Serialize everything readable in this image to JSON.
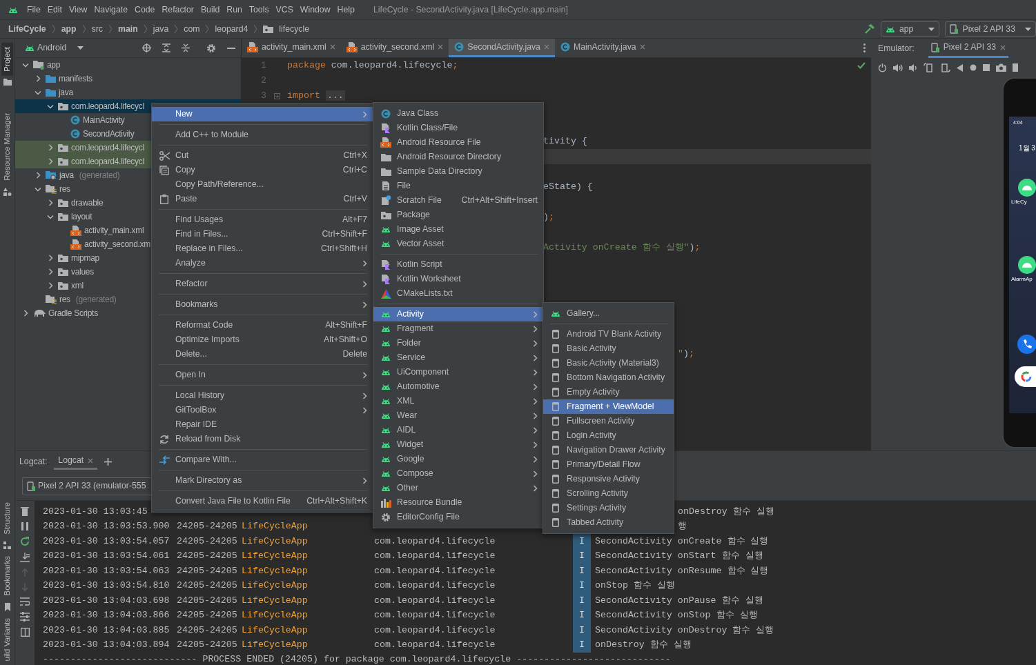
{
  "menubar": {
    "items": [
      "File",
      "Edit",
      "View",
      "Navigate",
      "Code",
      "Refactor",
      "Build",
      "Run",
      "Tools",
      "VCS",
      "Window",
      "Help"
    ],
    "title": "LifeCycle - SecondActivity.java [LifeCycle.app.main]"
  },
  "navbar": {
    "breadcrumbs": [
      {
        "label": "LifeCycle",
        "bold": true
      },
      {
        "label": "app",
        "bold": true
      },
      {
        "label": "src",
        "bold": false
      },
      {
        "label": "main",
        "bold": true
      },
      {
        "label": "java",
        "bold": false
      },
      {
        "label": "com",
        "bold": false
      },
      {
        "label": "leopard4",
        "bold": false
      },
      {
        "label": "lifecycle",
        "bold": false,
        "kind": "package"
      }
    ],
    "run_config": "app",
    "device": "Pixel 2 API 33"
  },
  "toolstrip": [
    {
      "label": "Project",
      "selected": true
    },
    {
      "label": "Resource Manager",
      "selected": false
    },
    {
      "label": "Structure",
      "selected": false
    },
    {
      "label": "Bookmarks",
      "selected": false
    },
    {
      "label": "uild Variants",
      "selected": false
    }
  ],
  "project": {
    "view": "Android",
    "tree": [
      {
        "label": "app",
        "kind": "module",
        "expanded": true,
        "selected": false,
        "children": [
          {
            "label": "manifests",
            "kind": "source",
            "expanded": false,
            "selected": false
          },
          {
            "label": "java",
            "kind": "source",
            "expanded": true,
            "selected": false,
            "children": [
              {
                "label": "com.leopard4.lifecycl",
                "kind": "package",
                "expanded": true,
                "selected": true,
                "children": [
                  {
                    "label": "MainActivity",
                    "kind": "class",
                    "selected": false
                  },
                  {
                    "label": "SecondActivity",
                    "kind": "class",
                    "selected": false
                  }
                ]
              },
              {
                "label": "com.leopard4.lifecycl",
                "kind": "package",
                "expanded": false,
                "selected": false,
                "test": true
              },
              {
                "label": "com.leopard4.lifecycl",
                "kind": "package",
                "expanded": false,
                "selected": false,
                "test": true
              }
            ]
          },
          {
            "label": "java",
            "suffix": "(generated)",
            "kind": "generated",
            "expanded": false,
            "selected": false
          },
          {
            "label": "res",
            "kind": "res",
            "expanded": true,
            "selected": false,
            "children": [
              {
                "label": "drawable",
                "kind": "package",
                "expanded": false,
                "selected": false
              },
              {
                "label": "layout",
                "kind": "package",
                "expanded": true,
                "selected": false,
                "children": [
                  {
                    "label": "activity_main.xml",
                    "kind": "xml",
                    "selected": false
                  },
                  {
                    "label": "activity_second.xm",
                    "kind": "xml",
                    "selected": false
                  }
                ]
              },
              {
                "label": "mipmap",
                "kind": "package",
                "expanded": false,
                "selected": false
              },
              {
                "label": "values",
                "kind": "package",
                "expanded": false,
                "selected": false
              },
              {
                "label": "xml",
                "kind": "package",
                "expanded": false,
                "selected": false
              }
            ]
          },
          {
            "label": "res",
            "suffix": "(generated)",
            "kind": "res",
            "selected": false
          }
        ]
      },
      {
        "label": "Gradle Scripts",
        "kind": "gradle",
        "expanded": false,
        "selected": false
      }
    ]
  },
  "editor": {
    "tabs": [
      {
        "label": "activity_main.xml",
        "kind": "xml",
        "selected": false
      },
      {
        "label": "activity_second.xml",
        "kind": "xml",
        "selected": false
      },
      {
        "label": "SecondActivity.java",
        "kind": "class",
        "selected": true
      },
      {
        "label": "MainActivity.java",
        "kind": "class",
        "selected": false
      }
    ],
    "analysis_ok": true,
    "lines": [
      {
        "number": "1",
        "fold_marker": false,
        "tokens": [
          {
            "text": "package",
            "kind": "keyword"
          },
          {
            "text": " com.leopard4.lifecycle",
            "kind": "plain"
          },
          {
            "text": ";",
            "kind": "keyword"
          }
        ]
      },
      {
        "number": "2",
        "fold_marker": false
      },
      {
        "number": "3",
        "fold_marker": true,
        "tokens": [
          {
            "text": "import",
            "kind": "keyword"
          },
          {
            "text": "...",
            "kind": "folded"
          }
        ]
      }
    ],
    "fragments": [
      {
        "current": false,
        "tokens": [
          {
            "text": "tivity {",
            "kind": "plain"
          }
        ]
      },
      {
        "current": true
      },
      {
        "current": false,
        "tokens": [
          {
            "text": "eState) {",
            "kind": "plain"
          }
        ]
      },
      {
        "current": false,
        "tokens": [
          {
            "text": ")",
            "kind": "plain"
          },
          {
            "text": ";",
            "kind": "keyword"
          }
        ]
      },
      {
        "current": false,
        "tokens": [
          {
            "text": "Activity onCreate 함수 실행\"",
            "kind": "string"
          },
          {
            "text": ")",
            "kind": "plain"
          },
          {
            "text": ";",
            "kind": "keyword"
          }
        ]
      },
      {
        "current": false,
        "tokens": [
          {
            "text": "\"",
            "kind": "string"
          },
          {
            "text": ")",
            "kind": "plain"
          },
          {
            "text": ";",
            "kind": "keyword"
          }
        ]
      }
    ]
  },
  "emulator": {
    "label": "Emulator:",
    "tab": "Pixel 2 API 33",
    "screen": {
      "time": "4:04",
      "date": "1월 3",
      "apps": [
        {
          "label": "LifeCy"
        },
        {
          "label": "AlarmAp"
        }
      ]
    }
  },
  "logcat": {
    "label": "Logcat:",
    "tab": "Logcat",
    "device": "Pixel 2 API 33 (emulator-555",
    "rows": [
      {
        "time": "2023-01-30 13:03:45",
        "message": "onDestroy 함수 실행",
        "partly_hidden": true
      },
      {
        "time": "2023-01-30 13:03:53.900",
        "pid": "24205-24205",
        "tag": "LifeCycleApp",
        "message": "행",
        "partly_hidden": true
      },
      {
        "time": "2023-01-30 13:03:54.057",
        "pid": "24205-24205",
        "tag": "LifeCycleApp",
        "package": "com.leopard4.lifecycle",
        "level": "I",
        "message": "SecondActivity onCreate 함수 실행",
        "partly_hidden": false
      },
      {
        "time": "2023-01-30 13:03:54.061",
        "pid": "24205-24205",
        "tag": "LifeCycleApp",
        "package": "com.leopard4.lifecycle",
        "level": "I",
        "message": "SecondActivity onStart 함수 실행",
        "partly_hidden": false
      },
      {
        "time": "2023-01-30 13:03:54.063",
        "pid": "24205-24205",
        "tag": "LifeCycleApp",
        "package": "com.leopard4.lifecycle",
        "level": "I",
        "message": "SecondActivity onResume 함수 실행",
        "partly_hidden": false
      },
      {
        "time": "2023-01-30 13:03:54.810",
        "pid": "24205-24205",
        "tag": "LifeCycleApp",
        "package": "com.leopard4.lifecycle",
        "level": "I",
        "message": "onStop 함수 실행",
        "partly_hidden": false
      },
      {
        "time": "2023-01-30 13:04:03.698",
        "pid": "24205-24205",
        "tag": "LifeCycleApp",
        "package": "com.leopard4.lifecycle",
        "level": "I",
        "message": "SecondActivity onPause 함수 실행",
        "partly_hidden": false
      },
      {
        "time": "2023-01-30 13:04:03.866",
        "pid": "24205-24205",
        "tag": "LifeCycleApp",
        "package": "com.leopard4.lifecycle",
        "level": "I",
        "message": "SecondActivity onStop 함수 실행",
        "partly_hidden": false
      },
      {
        "time": "2023-01-30 13:04:03.885",
        "pid": "24205-24205",
        "tag": "LifeCycleApp",
        "package": "com.leopard4.lifecycle",
        "level": "I",
        "message": "SecondActivity onDestroy 함수 실행",
        "partly_hidden": false
      },
      {
        "time": "2023-01-30 13:04:03.894",
        "pid": "24205-24205",
        "tag": "LifeCycleApp",
        "package": "com.leopard4.lifecycle",
        "level": "I",
        "message": "onDestroy 함수 실행",
        "partly_hidden": false
      }
    ],
    "footer": "---------------------------- PROCESS ENDED (24205) for package com.leopard4.lifecycle ----------------------------"
  },
  "context_menu": {
    "groups": [
      [
        {
          "label": "New",
          "submenu": true,
          "selected": true
        }
      ],
      [
        {
          "label": "Add C++ to Module",
          "submenu": false,
          "selected": false
        }
      ],
      [
        {
          "label": "Cut",
          "shortcut": "Ctrl+X",
          "kind": "cut",
          "submenu": false,
          "selected": false
        },
        {
          "label": "Copy",
          "shortcut": "Ctrl+C",
          "kind": "copy",
          "submenu": false,
          "selected": false
        },
        {
          "label": "Copy Path/Reference...",
          "submenu": false,
          "selected": false
        },
        {
          "label": "Paste",
          "shortcut": "Ctrl+V",
          "kind": "paste",
          "submenu": false,
          "selected": false
        }
      ],
      [
        {
          "label": "Find Usages",
          "shortcut": "Alt+F7",
          "submenu": false,
          "selected": false
        },
        {
          "label": "Find in Files...",
          "shortcut": "Ctrl+Shift+F",
          "submenu": false,
          "selected": false
        },
        {
          "label": "Replace in Files...",
          "shortcut": "Ctrl+Shift+H",
          "submenu": false,
          "selected": false
        },
        {
          "label": "Analyze",
          "submenu": true,
          "selected": false
        }
      ],
      [
        {
          "label": "Refactor",
          "submenu": true,
          "selected": false
        }
      ],
      [
        {
          "label": "Bookmarks",
          "submenu": true,
          "selected": false
        }
      ],
      [
        {
          "label": "Reformat Code",
          "shortcut": "Alt+Shift+F",
          "submenu": false,
          "selected": false
        },
        {
          "label": "Optimize Imports",
          "shortcut": "Alt+Shift+O",
          "submenu": false,
          "selected": false
        },
        {
          "label": "Delete...",
          "shortcut": "Delete",
          "submenu": false,
          "selected": false
        }
      ],
      [
        {
          "label": "Open In",
          "submenu": true,
          "selected": false
        }
      ],
      [
        {
          "label": "Local History",
          "submenu": true,
          "selected": false
        },
        {
          "label": "GitToolBox",
          "submenu": true,
          "selected": false
        },
        {
          "label": "Repair IDE",
          "submenu": false,
          "selected": false
        },
        {
          "label": "Reload from Disk",
          "kind": "reload",
          "submenu": false,
          "selected": false
        }
      ],
      [
        {
          "label": "Compare With...",
          "kind": "compare",
          "submenu": false,
          "selected": false
        }
      ],
      [
        {
          "label": "Mark Directory as",
          "submenu": true,
          "selected": false
        }
      ],
      [
        {
          "label": "Convert Java File to Kotlin File",
          "shortcut": "Ctrl+Alt+Shift+K",
          "submenu": false,
          "selected": false
        }
      ]
    ]
  },
  "new_menu": {
    "groups": [
      [
        {
          "label": "Java Class",
          "kind": "class",
          "submenu": false,
          "selected": false
        },
        {
          "label": "Kotlin Class/File",
          "kind": "kotlin",
          "submenu": false,
          "selected": false
        },
        {
          "label": "Android Resource File",
          "kind": "xml",
          "submenu": false,
          "selected": false
        },
        {
          "label": "Android Resource Directory",
          "kind": "folder",
          "submenu": false,
          "selected": false
        },
        {
          "label": "Sample Data Directory",
          "kind": "folder",
          "submenu": false,
          "selected": false
        },
        {
          "label": "File",
          "kind": "file",
          "submenu": false,
          "selected": false
        },
        {
          "label": "Scratch File",
          "shortcut": "Ctrl+Alt+Shift+Insert",
          "kind": "scratch",
          "submenu": false,
          "selected": false
        },
        {
          "label": "Package",
          "kind": "package",
          "submenu": false,
          "selected": false
        },
        {
          "label": "Image Asset",
          "kind": "android",
          "submenu": false,
          "selected": false
        },
        {
          "label": "Vector Asset",
          "kind": "android",
          "submenu": false,
          "selected": false
        }
      ],
      [
        {
          "label": "Kotlin Script",
          "kind": "kotlin",
          "submenu": false,
          "selected": false
        },
        {
          "label": "Kotlin Worksheet",
          "kind": "kotlin",
          "submenu": false,
          "selected": false
        },
        {
          "label": "CMakeLists.txt",
          "kind": "cmake",
          "submenu": false,
          "selected": false
        }
      ],
      [
        {
          "label": "Activity",
          "kind": "android",
          "submenu": true,
          "selected": true
        },
        {
          "label": "Fragment",
          "kind": "android",
          "submenu": true,
          "selected": false
        },
        {
          "label": "Folder",
          "kind": "android",
          "submenu": true,
          "selected": false
        },
        {
          "label": "Service",
          "kind": "android",
          "submenu": true,
          "selected": false
        },
        {
          "label": "UiComponent",
          "kind": "android",
          "submenu": true,
          "selected": false
        },
        {
          "label": "Automotive",
          "kind": "android",
          "submenu": true,
          "selected": false
        },
        {
          "label": "XML",
          "kind": "android",
          "submenu": true,
          "selected": false
        },
        {
          "label": "Wear",
          "kind": "android",
          "submenu": true,
          "selected": false
        },
        {
          "label": "AIDL",
          "kind": "android",
          "submenu": true,
          "selected": false
        },
        {
          "label": "Widget",
          "kind": "android",
          "submenu": true,
          "selected": false
        },
        {
          "label": "Google",
          "kind": "android",
          "submenu": true,
          "selected": false
        },
        {
          "label": "Compose",
          "kind": "android",
          "submenu": true,
          "selected": false
        },
        {
          "label": "Other",
          "kind": "android",
          "submenu": true,
          "selected": false
        },
        {
          "label": "Resource Bundle",
          "kind": "bundle",
          "submenu": false,
          "selected": false
        },
        {
          "label": "EditorConfig File",
          "kind": "gear",
          "submenu": false,
          "selected": false
        }
      ]
    ]
  },
  "activity_menu": {
    "groups": [
      [
        {
          "label": "Gallery...",
          "kind": "android",
          "submenu": false,
          "selected": false
        }
      ],
      [
        {
          "label": "Android TV Blank Activity",
          "kind": "layout",
          "submenu": false,
          "selected": false
        },
        {
          "label": "Basic Activity",
          "kind": "layout",
          "submenu": false,
          "selected": false
        },
        {
          "label": "Basic Activity (Material3)",
          "kind": "layout",
          "submenu": false,
          "selected": false
        },
        {
          "label": "Bottom Navigation Activity",
          "kind": "layout",
          "submenu": false,
          "selected": false
        },
        {
          "label": "Empty Activity",
          "kind": "layout",
          "submenu": false,
          "selected": false
        },
        {
          "label": "Fragment + ViewModel",
          "kind": "layout",
          "submenu": false,
          "selected": true
        },
        {
          "label": "Fullscreen Activity",
          "kind": "layout",
          "submenu": false,
          "selected": false
        },
        {
          "label": "Login Activity",
          "kind": "layout",
          "submenu": false,
          "selected": false
        },
        {
          "label": "Navigation Drawer Activity",
          "kind": "layout",
          "submenu": false,
          "selected": false
        },
        {
          "label": "Primary/Detail Flow",
          "kind": "layout",
          "submenu": false,
          "selected": false
        },
        {
          "label": "Responsive Activity",
          "kind": "layout",
          "submenu": false,
          "selected": false
        },
        {
          "label": "Scrolling Activity",
          "kind": "layout",
          "submenu": false,
          "selected": false
        },
        {
          "label": "Settings Activity",
          "kind": "layout",
          "submenu": false,
          "selected": false
        },
        {
          "label": "Tabbed Activity",
          "kind": "layout",
          "submenu": false,
          "selected": false
        }
      ]
    ]
  }
}
